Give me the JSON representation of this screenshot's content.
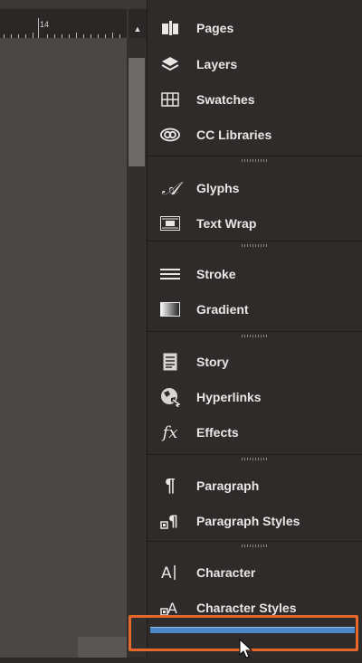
{
  "ruler": {
    "label": "14"
  },
  "panels": [
    {
      "id": "pages",
      "label": "Pages",
      "icon": "pages-icon"
    },
    {
      "id": "layers",
      "label": "Layers",
      "icon": "layers-icon"
    },
    {
      "id": "swatches",
      "label": "Swatches",
      "icon": "swatches-icon"
    },
    {
      "id": "cc-libraries",
      "label": "CC Libraries",
      "icon": "cc-libraries-icon"
    },
    {
      "id": "glyphs",
      "label": "Glyphs",
      "icon": "glyphs-icon"
    },
    {
      "id": "text-wrap",
      "label": "Text Wrap",
      "icon": "text-wrap-icon"
    },
    {
      "id": "stroke",
      "label": "Stroke",
      "icon": "stroke-icon"
    },
    {
      "id": "gradient",
      "label": "Gradient",
      "icon": "gradient-icon"
    },
    {
      "id": "story",
      "label": "Story",
      "icon": "story-icon"
    },
    {
      "id": "hyperlinks",
      "label": "Hyperlinks",
      "icon": "hyperlinks-icon"
    },
    {
      "id": "effects",
      "label": "Effects",
      "icon": "effects-icon"
    },
    {
      "id": "paragraph",
      "label": "Paragraph",
      "icon": "paragraph-icon"
    },
    {
      "id": "paragraph-styles",
      "label": "Paragraph Styles",
      "icon": "paragraph-styles-icon"
    },
    {
      "id": "character",
      "label": "Character",
      "icon": "character-icon"
    },
    {
      "id": "character-styles",
      "label": "Character Styles",
      "icon": "character-styles-icon"
    }
  ],
  "colors": {
    "highlight": "#e6692b",
    "drop_bar": "#4c86c7",
    "panel_bg": "#2f2b2b"
  }
}
